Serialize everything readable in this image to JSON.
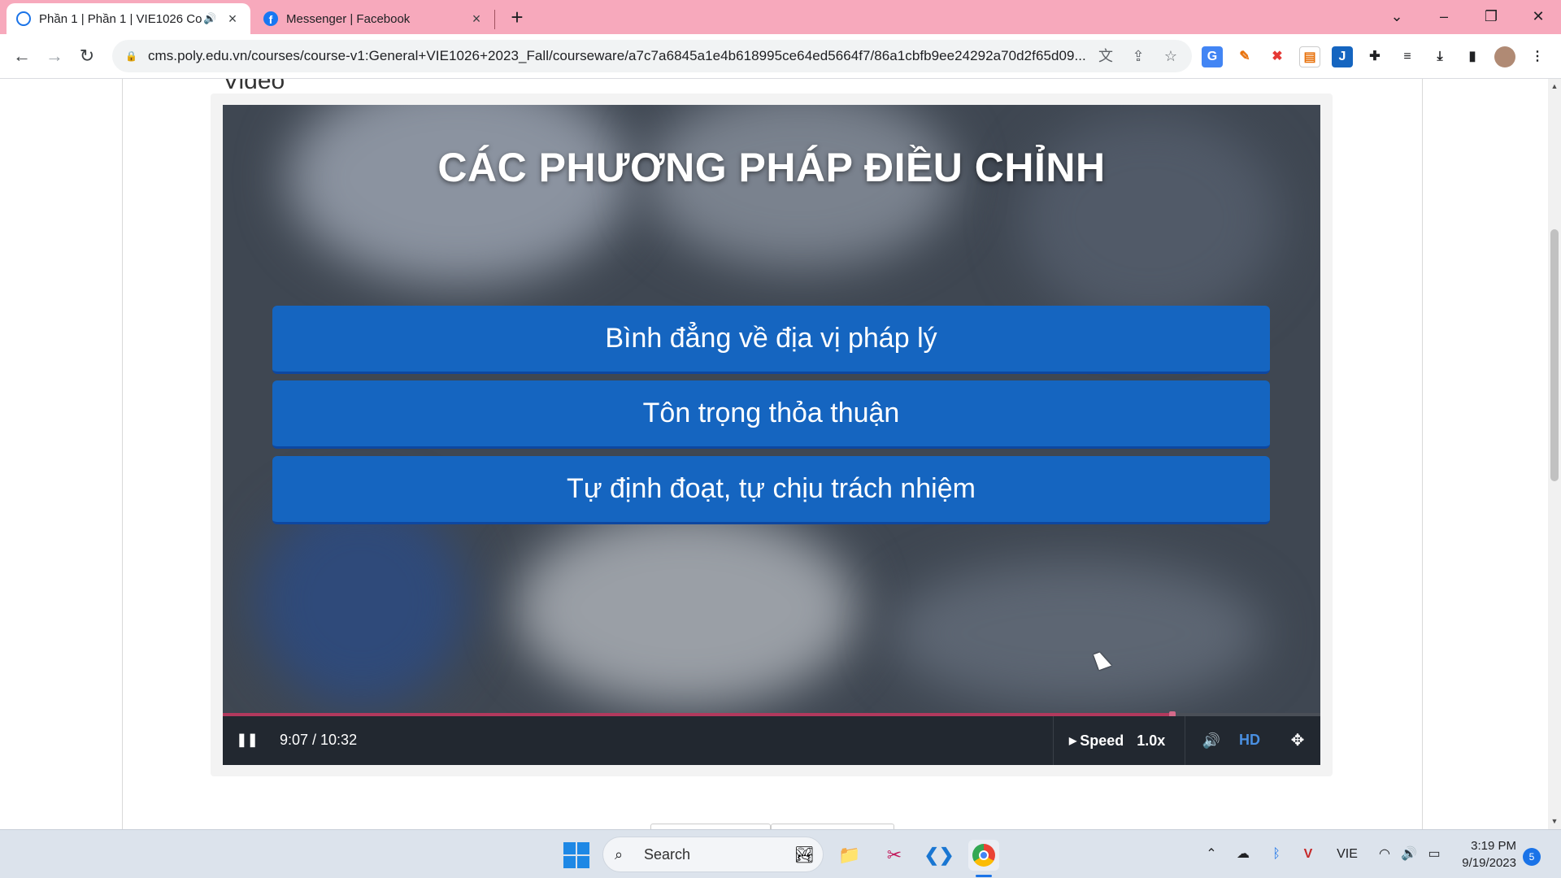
{
  "browser": {
    "tabs": [
      {
        "title": "Phần 1 | Phần 1 | VIE1026 Co",
        "active": true,
        "audio": true
      },
      {
        "title": "Messenger | Facebook",
        "active": false
      }
    ],
    "new_tab_label": "+",
    "url": "cms.poly.edu.vn/courses/course-v1:General+VIE1026+2023_Fall/courseware/a7c7a6845a1e4b618995ce64ed5664f7/86a1cbfb9ee24292a70d2f65d09..."
  },
  "page": {
    "section_title": "Video",
    "slide": {
      "title": "CÁC PHƯƠNG PHÁP ĐIỀU CHỈNH",
      "options": [
        "Bình đẳng về địa vị pháp lý",
        "Tôn trọng thỏa thuận",
        "Tự định đoạt, tự chịu trách nhiệm"
      ]
    },
    "player": {
      "time": "9:07 / 10:32",
      "progress": 0.865,
      "speed_label": "Speed",
      "speed_value": "1.0x",
      "hd_label": "HD"
    }
  },
  "taskbar": {
    "search_label": "Search",
    "language": "VIE",
    "time": "3:19 PM",
    "date": "9/19/2023",
    "notification_count": "5"
  },
  "colors": {
    "tabstrip": "#f7a9bc",
    "option_box": "#1565c0",
    "progress": "#b2395d",
    "hd": "#4a90e2"
  }
}
